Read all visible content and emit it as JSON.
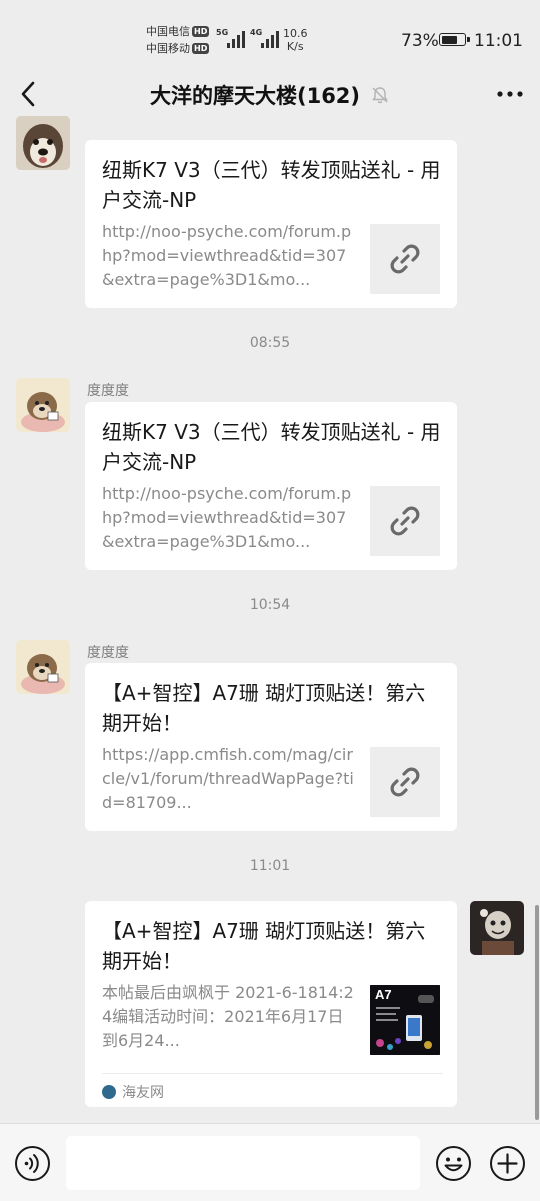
{
  "status_bar": {
    "carrier1": "中国电信",
    "carrier2": "中国移动",
    "hd_badge": "HD",
    "sim1_generation": "5G",
    "sim2_generation": "4G",
    "net_speed_value": "10.6",
    "net_speed_unit": "K/s",
    "battery_percent_label": "73%",
    "battery_level": 0.73,
    "time": "11:01"
  },
  "header": {
    "title": "大洋的摩天大楼(162)",
    "icons": {
      "back": "chevron-left-icon",
      "mute": "bell-off-icon",
      "more": "more-dots-icon"
    }
  },
  "messages": [
    {
      "type": "link-card",
      "sender": "",
      "avatar": "dog-avatar",
      "title": "纽斯K7 V3（三代）转发顶贴送礼 - 用户交流-NP",
      "description": "http://noo-psyche.com/forum.php?mod=viewthread&tid=307&extra=page%3D1&mo...",
      "thumbnail": "link-icon"
    },
    {
      "type": "timestamp",
      "text": "08:55"
    },
    {
      "type": "link-card",
      "sender": "度度度",
      "avatar": "cartoon-dog-avatar",
      "title": "纽斯K7 V3（三代）转发顶贴送礼 - 用户交流-NP",
      "description": "http://noo-psyche.com/forum.php?mod=viewthread&tid=307&extra=page%3D1&mo...",
      "thumbnail": "link-icon"
    },
    {
      "type": "timestamp",
      "text": "10:54"
    },
    {
      "type": "link-card",
      "sender": "度度度",
      "avatar": "cartoon-dog-avatar",
      "title": "【A+智控】A7珊 瑚灯顶贴送！第六期开始！",
      "description": "https://app.cmfish.com/mag/circle/v1/forum/threadWapPage?tid=81709...",
      "thumbnail": "link-icon"
    },
    {
      "type": "timestamp",
      "text": "11:01"
    },
    {
      "type": "link-card",
      "sender": "",
      "avatar": "self-avatar",
      "title": "【A+智控】A7珊 瑚灯顶贴送！第六期开始！",
      "description": "本帖最后由飒枫于 2021-6-1814:24编辑活动时间：2021年6月17日到6月24...",
      "thumbnail_caption": "A7",
      "source": "海友网"
    }
  ],
  "input_bar": {
    "placeholder": "",
    "icons": {
      "voice": "voice-icon",
      "emoji": "emoji-icon",
      "plus": "plus-icon"
    }
  },
  "colors": {
    "background": "#ededed",
    "card": "#ffffff",
    "secondary_text": "#8a8a8a"
  }
}
